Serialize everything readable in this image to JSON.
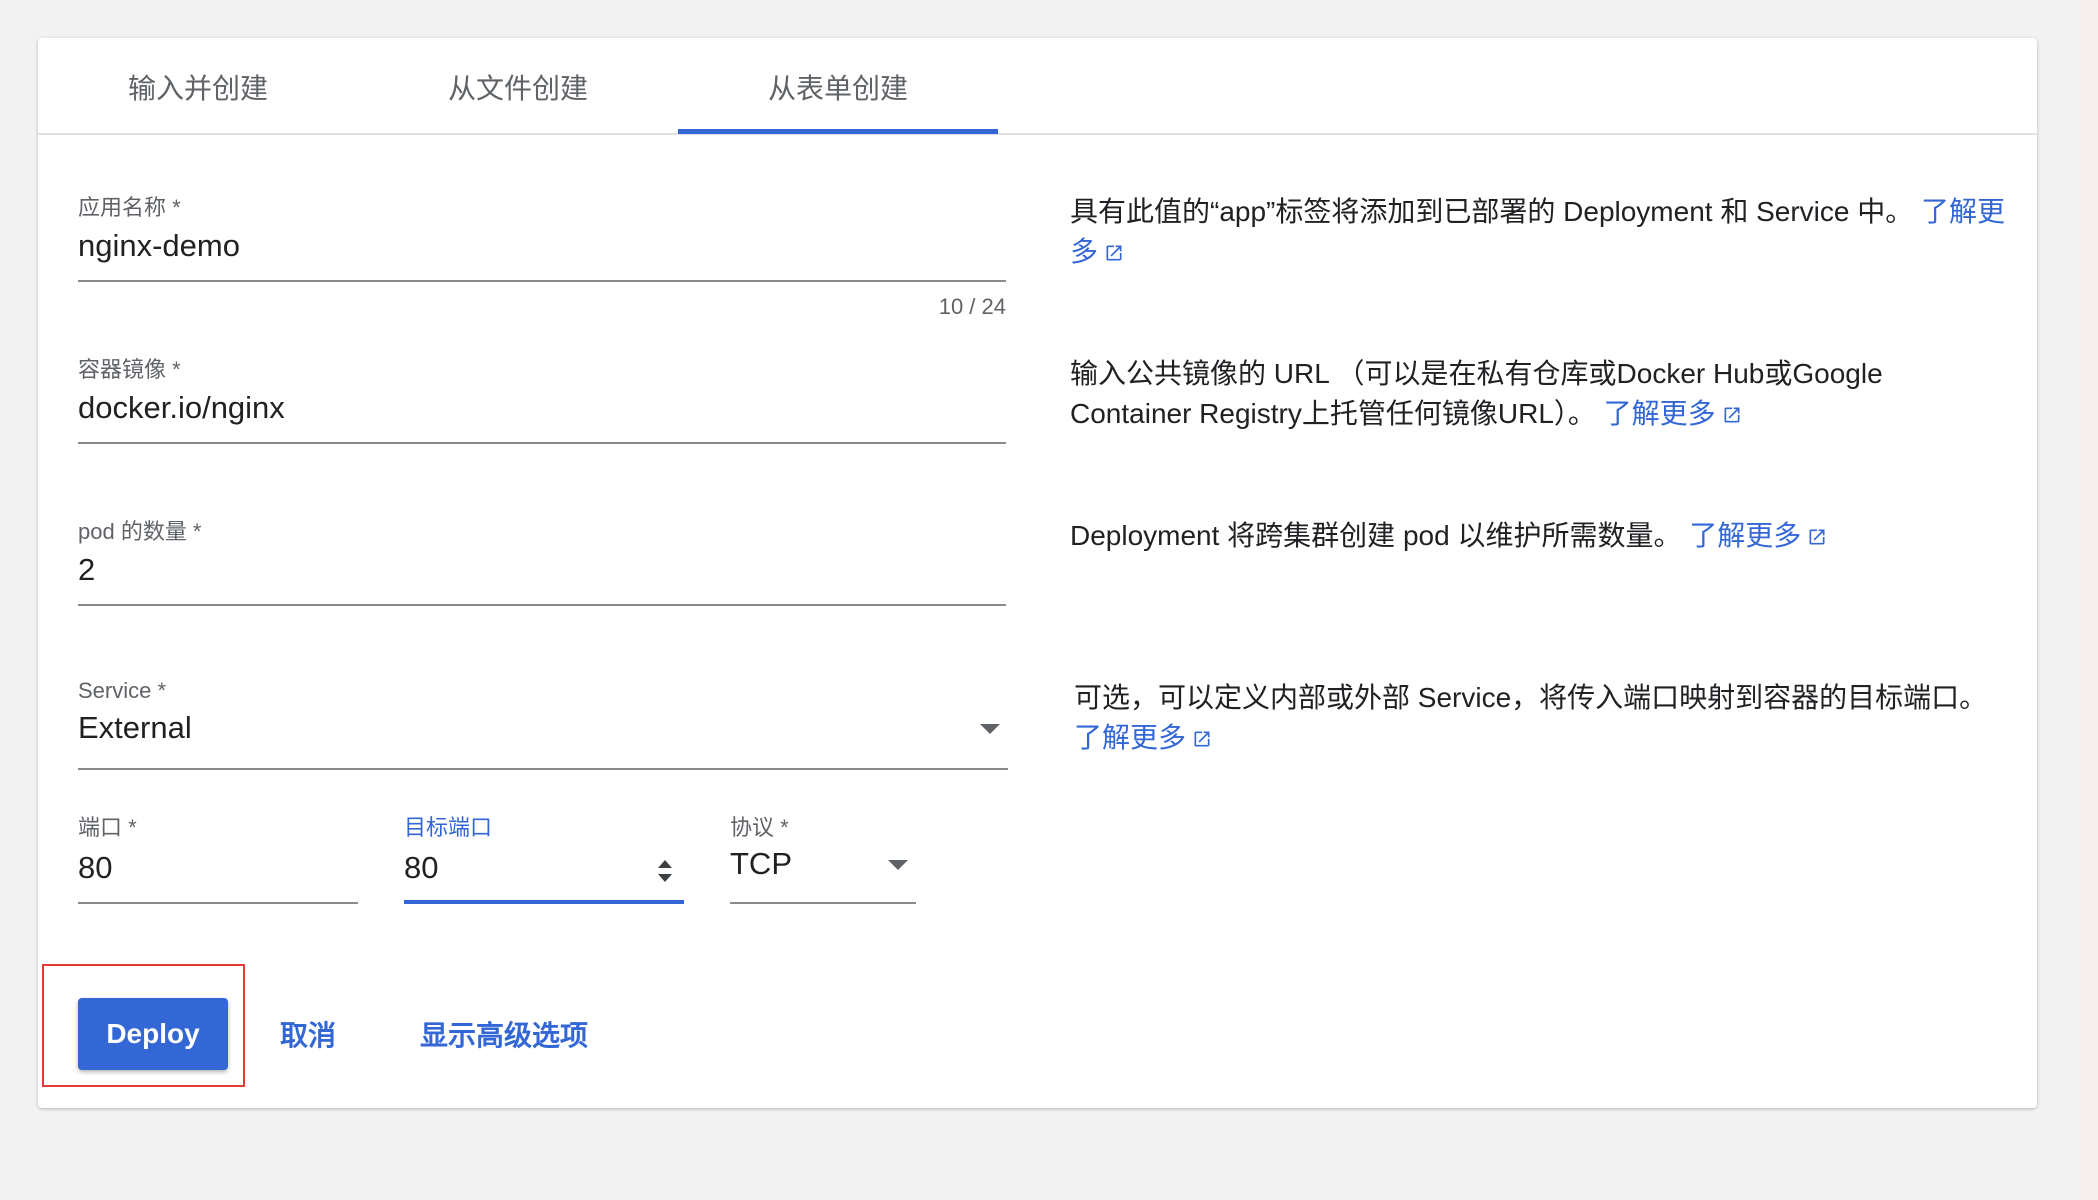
{
  "tabs": [
    {
      "label": "输入并创建"
    },
    {
      "label": "从文件创建"
    },
    {
      "label": "从表单创建"
    }
  ],
  "active_tab": 2,
  "form": {
    "app_name": {
      "label": "应用名称 *",
      "value": "nginx-demo",
      "counter": "10 / 24"
    },
    "image": {
      "label": "容器镜像 *",
      "value": "docker.io/nginx"
    },
    "pods": {
      "label": "pod 的数量 *",
      "value": "2"
    },
    "service": {
      "label": "Service *",
      "value": "External"
    },
    "port": {
      "label": "端口 *",
      "value": "80"
    },
    "target_port": {
      "label": "目标端口",
      "value": "80"
    },
    "protocol": {
      "label": "协议 *",
      "value": "TCP"
    }
  },
  "help": {
    "app_name": {
      "text": "具有此值的“app”标签将添加到已部署的 Deployment 和 Service 中。",
      "link": "了解更多"
    },
    "image": {
      "text": "输入公共镜像的 URL （可以是在私有仓库或Docker Hub或Google Container Registry上托管任何镜像URL）。",
      "link": "了解更多"
    },
    "pods": {
      "text": "Deployment 将跨集群创建 pod 以维护所需数量。",
      "link": "了解更多"
    },
    "service": {
      "text": "可选，可以定义内部或外部 Service，将传入端口映射到容器的目标端口。",
      "link": "了解更多"
    }
  },
  "actions": {
    "deploy": "Deploy",
    "cancel": "取消",
    "advanced": "显示高级选项"
  },
  "colors": {
    "accent": "#3367d6",
    "highlight": "#e53935"
  }
}
